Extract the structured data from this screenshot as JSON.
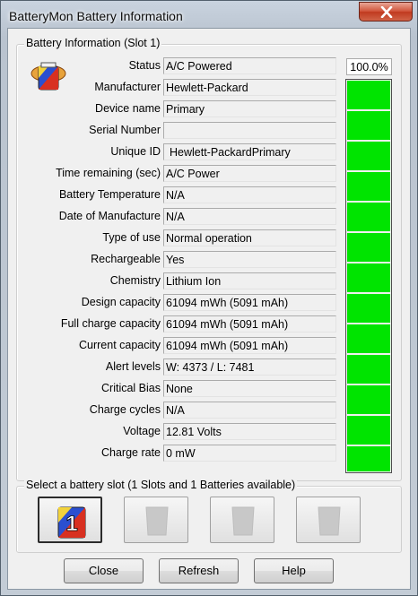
{
  "window": {
    "title": "BatteryMon Battery Information"
  },
  "info_group": {
    "title": "Battery Information (Slot 1)",
    "rows": [
      {
        "label": "Status",
        "value": "A/C Powered"
      },
      {
        "label": "Manufacturer",
        "value": "Hewlett-Packard"
      },
      {
        "label": "Device name",
        "value": "Primary"
      },
      {
        "label": "Serial Number",
        "value": ""
      },
      {
        "label": "Unique ID",
        "value": "Hewlett-PackardPrimary"
      },
      {
        "label": "Time remaining (sec)",
        "value": "A/C Power"
      },
      {
        "label": "Battery Temperature",
        "value": "N/A"
      },
      {
        "label": "Date of Manufacture",
        "value": "N/A"
      },
      {
        "label": "Type of use",
        "value": "Normal operation"
      },
      {
        "label": "Rechargeable",
        "value": "Yes"
      },
      {
        "label": "Chemistry",
        "value": "Lithium Ion"
      },
      {
        "label": "Design capacity",
        "value": "61094 mWh (5091 mAh)"
      },
      {
        "label": "Full charge capacity",
        "value": "61094 mWh (5091 mAh)"
      },
      {
        "label": "Current capacity",
        "value": "61094 mWh (5091 mAh)"
      },
      {
        "label": "Alert levels",
        "value": "W: 4373 / L: 7481"
      },
      {
        "label": "Critical Bias",
        "value": "None"
      },
      {
        "label": "Charge cycles",
        "value": "N/A"
      },
      {
        "label": "Voltage",
        "value": "12.81 Volts"
      },
      {
        "label": "Charge rate",
        "value": "0 mW"
      }
    ],
    "percent_text": "100.0%",
    "charge_level": 1.0,
    "fill_color": "#00e400"
  },
  "slot_group": {
    "title": "Select a battery slot (1 Slots and 1 Batteries available)",
    "slots": [
      {
        "icon": "battery-slot-1-icon",
        "number": "1",
        "active": true
      },
      {
        "icon": "empty-slot-icon",
        "active": false
      },
      {
        "icon": "empty-slot-icon",
        "active": false
      },
      {
        "icon": "empty-slot-icon",
        "active": false
      }
    ]
  },
  "buttons": {
    "close": "Close",
    "refresh": "Refresh",
    "help": "Help"
  },
  "colors": {
    "close_button": "#c7442a",
    "accent_blue": "#1f4fcf",
    "accent_red": "#d0281a"
  }
}
